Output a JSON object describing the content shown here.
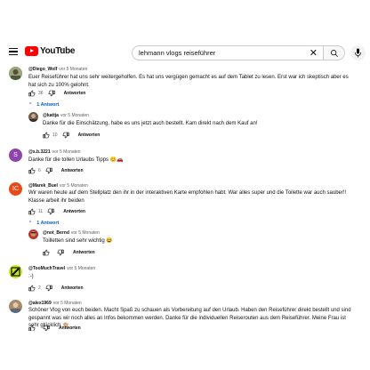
{
  "header": {
    "logo_text": "YouTube",
    "country_code": "DE",
    "search_value": "lehmann vlogs reiseführer"
  },
  "comments": [
    {
      "author": "@Diego_Wolf",
      "time": "vor 5 Monaten",
      "text": "Euer Reiseführer hat uns sehr weitergeholfen. Es hat uns vergügen gemacht es auf dem Tablet zu lesen. Erst war ich skeptisch aber es hat sich zu 100% gelohnt.",
      "likes": "36",
      "reply_label": "Antworten",
      "replies_toggle": "1 Antwort",
      "avatar_color": "#7b8a6a"
    },
    {
      "author": "@kattja",
      "time": "vor 5 Monaten",
      "text": "Danke für die Einschätzung, habe es uns jetzt auch bestellt. Kam direkt nach dem Kauf an!",
      "likes": "10",
      "reply_label": "Antworten",
      "avatar_color": "#5a4a3e"
    },
    {
      "author": "@s.b.3221",
      "time": "vor 5 Monaten",
      "text": "Danke für die tollen Urlaubs Tipps 😊🚗",
      "likes": "6",
      "reply_label": "Antworten",
      "avatar_letter": "S",
      "avatar_color": "#8e44ad"
    },
    {
      "author": "@Marek_Buel",
      "time": "vor 5 Monaten",
      "text": "Wir waren heute auf dem Stellplatz den ihr in der interaktiven Karte empfohlen habt. War alles super und die Toilette war auch sauber!! Klasse arbeit ihr beiden",
      "likes": "11",
      "reply_label": "Antworten",
      "replies_toggle": "1 Antwort",
      "avatar_letter": "IC",
      "avatar_color": "#e64a19"
    },
    {
      "author": "@not_Bernd",
      "time": "vor 5 Monaten",
      "text": "Toilletten sind sehr wichtig 😆",
      "reply_label": "Antworten",
      "avatar_color": "#b03a2e"
    },
    {
      "author": "@TooMuchTravel",
      "time": "vor 5 Monaten",
      "text": ":-)",
      "likes": "2",
      "reply_label": "Antworten",
      "avatar_color": "#c8e619"
    },
    {
      "author": "@alex1969",
      "time": "vor 5 Monaten",
      "text": "Schöner Vlog von euch beiden. Macht Spaß zu schauen als Vorbereitung auf den Urlaub. Haben den Reiseführer direkt bestellt und sind gespannt was wir noch alles an Infos bekommen werden. Danke für die individuellen Reiserouten aus dem Reiseführer. Meine Frau ist sehr glücklich 👏🏼",
      "reply_label": "Antworten",
      "avatar_color": "#8a6a4a"
    }
  ]
}
